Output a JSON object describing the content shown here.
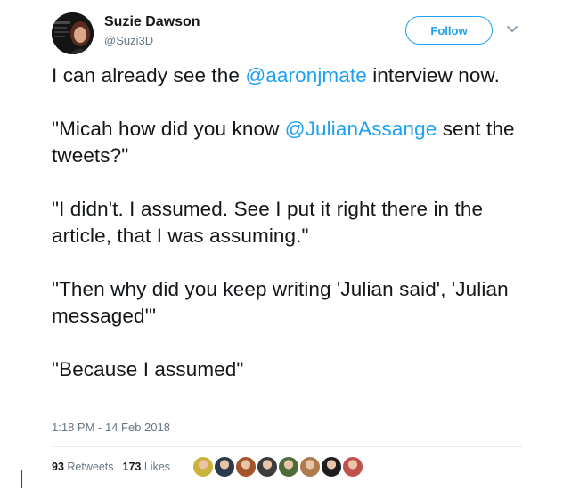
{
  "user": {
    "name": "Suzie Dawson",
    "handle": "@Suzi3D",
    "follow_label": "Follow"
  },
  "tweet": {
    "paragraphs": [
      [
        {
          "text": "I can already see the ",
          "type": "text"
        },
        {
          "text": "@aaronjmate",
          "type": "mention"
        },
        {
          "text": " interview now.",
          "type": "text"
        }
      ],
      [
        {
          "text": "\"Micah how did you know ",
          "type": "text"
        },
        {
          "text": "@JulianAssange",
          "type": "mention"
        },
        {
          "text": " sent the tweets?\"",
          "type": "text"
        }
      ],
      [
        {
          "text": "\"I didn't. I assumed. See I put it right there in the article, that I was assuming.\"",
          "type": "text"
        }
      ],
      [
        {
          "text": "\"Then why did you keep writing 'Julian said', 'Julian messaged'\"",
          "type": "text"
        }
      ],
      [
        {
          "text": "\"Because I assumed\"",
          "type": "text"
        }
      ]
    ],
    "timestamp": "1:18 PM - 14 Feb 2018"
  },
  "stats": {
    "retweets_count": "93",
    "retweets_label": "Retweets",
    "likes_count": "173",
    "likes_label": "Likes"
  },
  "likers": [
    {
      "icon": "liker-avatar",
      "color": "#c9b33a"
    },
    {
      "icon": "liker-avatar",
      "color": "#2b3a4a"
    },
    {
      "icon": "liker-avatar",
      "color": "#a4532a"
    },
    {
      "icon": "liker-avatar",
      "color": "#3c3c3c"
    },
    {
      "icon": "liker-avatar",
      "color": "#4e6b3a"
    },
    {
      "icon": "liker-avatar",
      "color": "#b07a4f"
    },
    {
      "icon": "liker-avatar",
      "color": "#1e1e1e"
    },
    {
      "icon": "liker-avatar",
      "color": "#c0504d"
    }
  ],
  "colors": {
    "accent": "#1da1f2",
    "text": "#14171a",
    "muted": "#657786"
  }
}
